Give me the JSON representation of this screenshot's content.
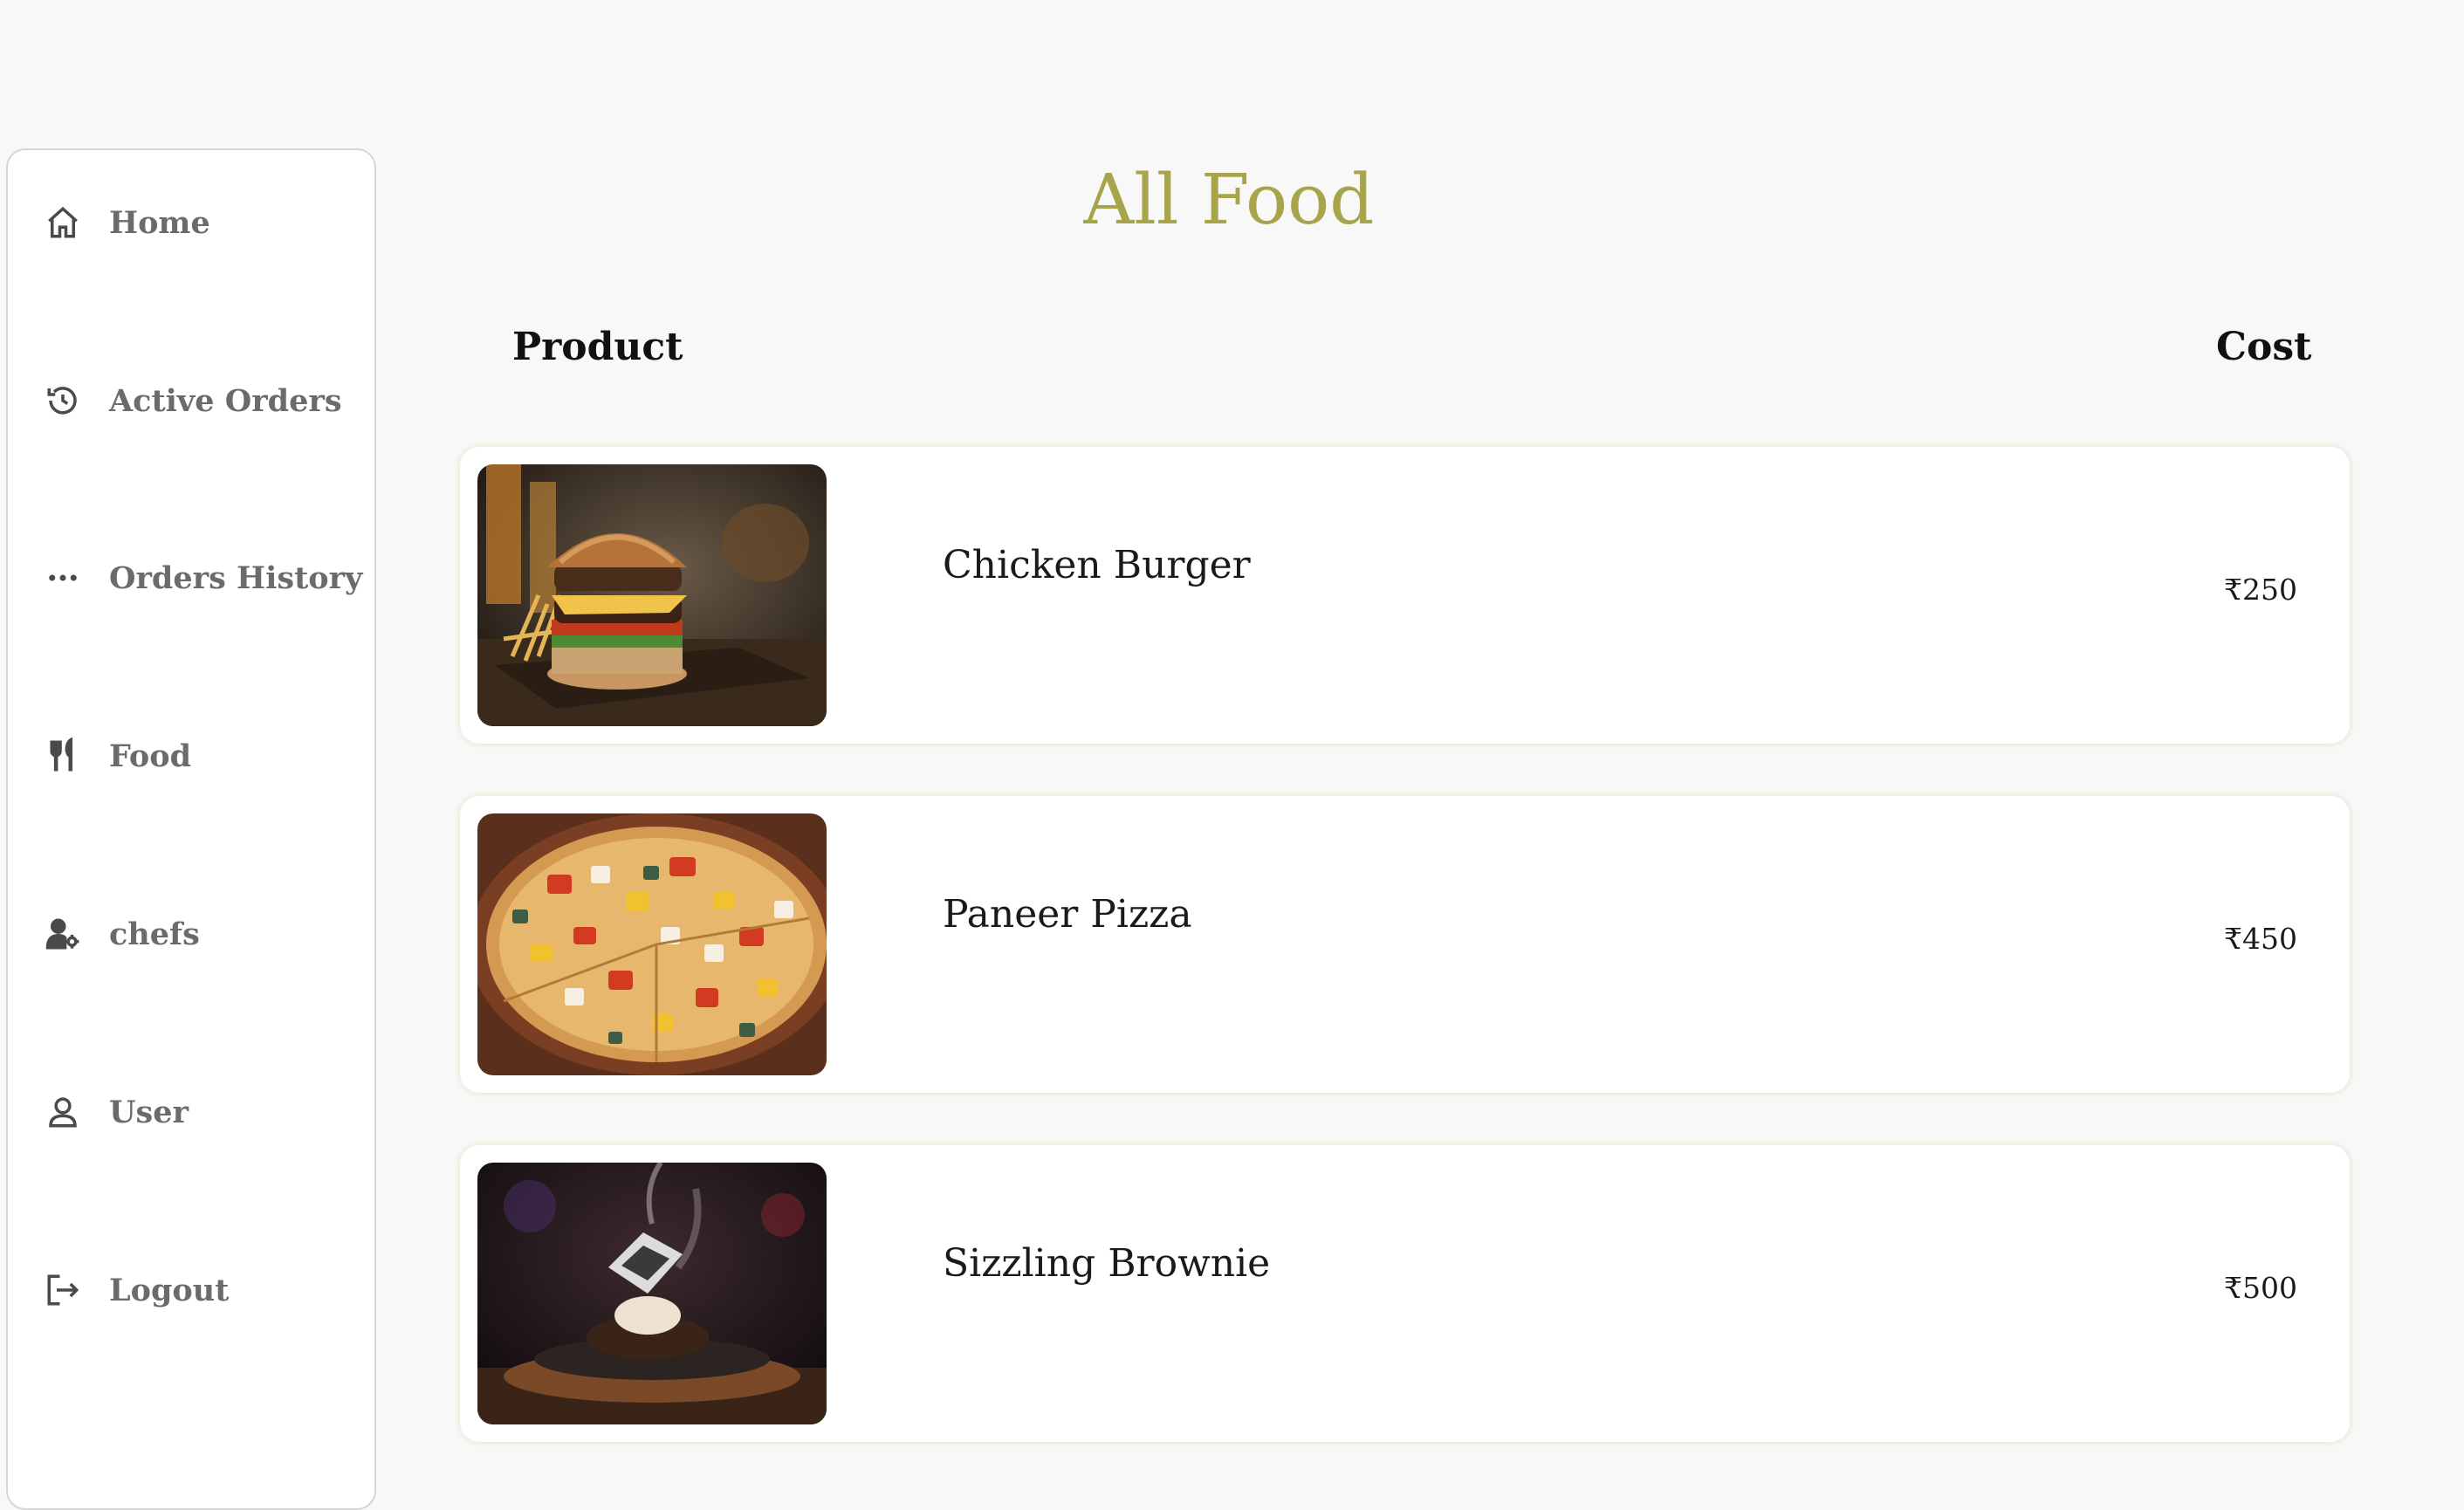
{
  "sidebar": {
    "items": [
      {
        "label": "Home",
        "icon": "home-icon"
      },
      {
        "label": "Active Orders",
        "icon": "history-icon"
      },
      {
        "label": "Orders History",
        "icon": "more-dots-icon"
      },
      {
        "label": "Food",
        "icon": "utensils-icon"
      },
      {
        "label": "chefs",
        "icon": "user-gear-icon"
      },
      {
        "label": "User",
        "icon": "user-icon"
      },
      {
        "label": "Logout",
        "icon": "logout-icon"
      }
    ]
  },
  "page": {
    "title": "All Food",
    "columns": {
      "product": "Product",
      "cost": "Cost"
    }
  },
  "products": [
    {
      "name": "Chicken Burger",
      "price": "₹250",
      "image": "burger-photo"
    },
    {
      "name": "Paneer Pizza",
      "price": "₹450",
      "image": "pizza-photo"
    },
    {
      "name": "Sizzling Brownie",
      "price": "₹500",
      "image": "brownie-photo"
    }
  ],
  "colors": {
    "title": "#a7a44b",
    "background": "#f8f8f8",
    "sidebar_text": "#6b6b6b"
  }
}
